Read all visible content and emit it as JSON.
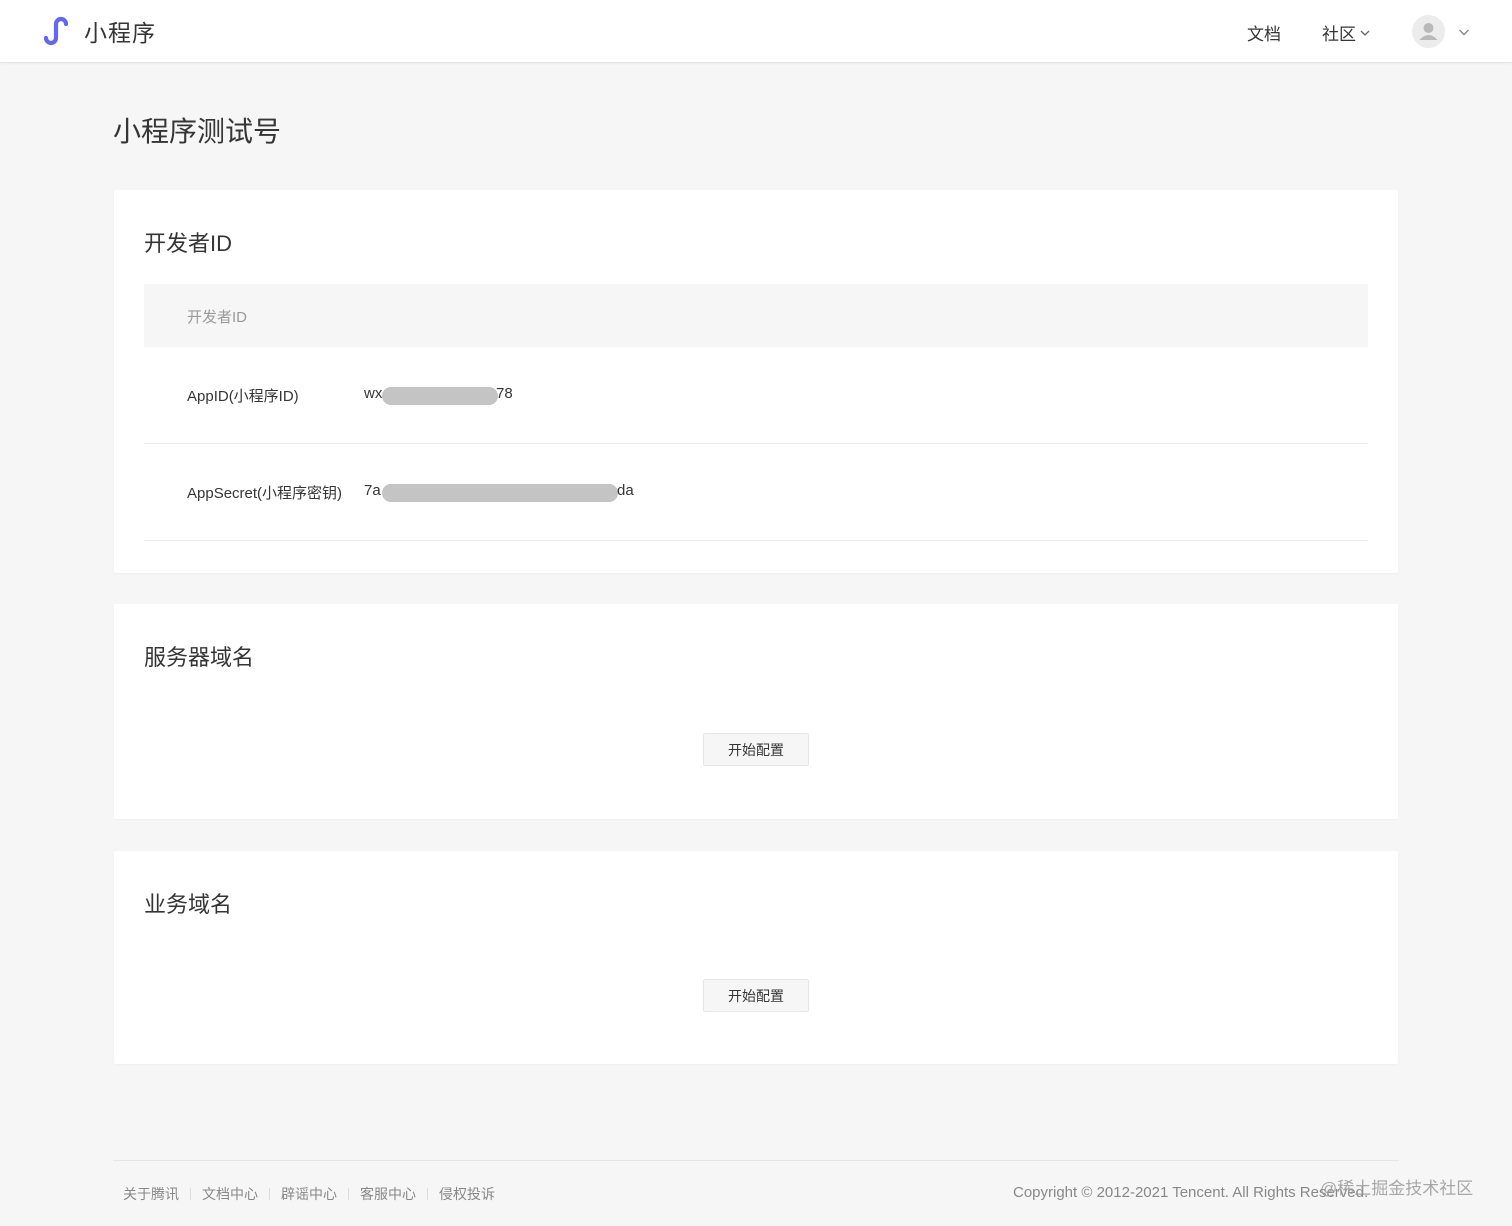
{
  "header": {
    "logo_text": "小程序",
    "nav_docs": "文档",
    "nav_community": "社区",
    "logo_icon": "mini-program-icon",
    "brand_color": "#6467f0"
  },
  "page": {
    "title": "小程序测试号"
  },
  "developer_card": {
    "title": "开发者ID",
    "table_header": "开发者ID",
    "rows": [
      {
        "label": "AppID(小程序ID)",
        "value_prefix": "wx",
        "value_suffix": "78"
      },
      {
        "label": "AppSecret(小程序密钥)",
        "value_prefix": "7a",
        "value_suffix": "da"
      }
    ]
  },
  "server_card": {
    "title": "服务器域名",
    "button": "开始配置"
  },
  "business_card": {
    "title": "业务域名",
    "button": "开始配置"
  },
  "footer": {
    "links": [
      "关于腾讯",
      "文档中心",
      "辟谣中心",
      "客服中心",
      "侵权投诉"
    ],
    "copyright": "Copyright © 2012-2021 Tencent. All Rights Reserved.",
    "watermark": "@稀土掘金技术社区"
  }
}
